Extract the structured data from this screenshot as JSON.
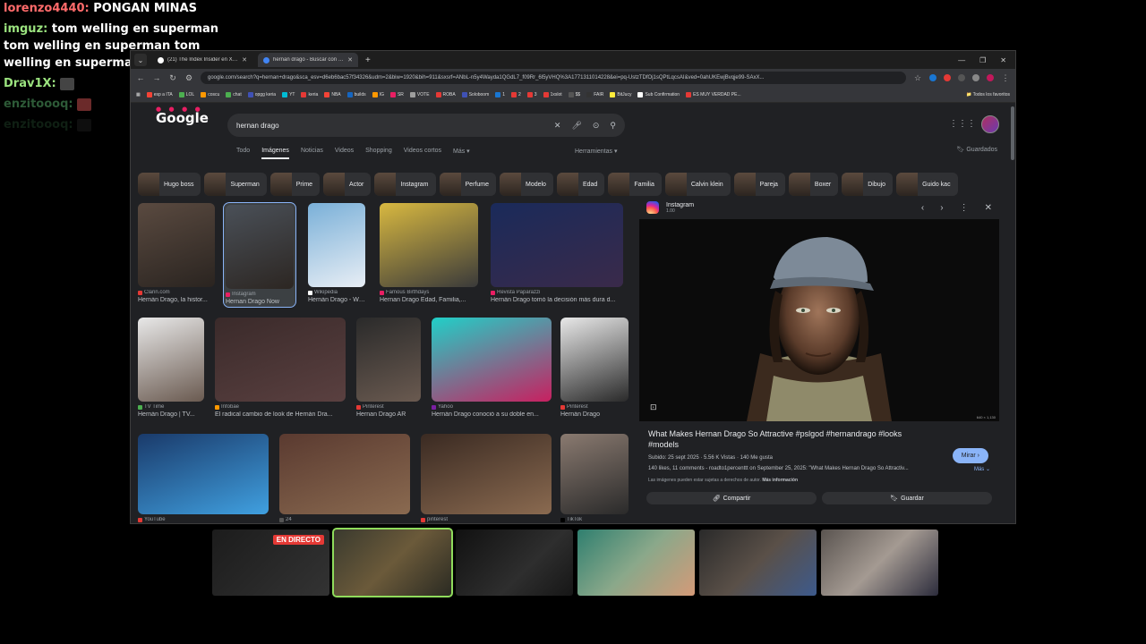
{
  "chat": [
    {
      "user": "lorenzo4440:",
      "msg": "PONGAN MINAS",
      "color": "red"
    },
    {
      "user": "imguz:",
      "msg": "tom welling en superman tom welling en superman tom welling en superman",
      "color": "green"
    },
    {
      "user": "Drav1X:",
      "msg": "",
      "color": "green",
      "emote": true
    },
    {
      "user": "enzitoooq:",
      "msg": "",
      "color": "faint",
      "emote": true
    },
    {
      "user": "enzitoooq:",
      "msg": "",
      "color": "faint",
      "emote": true,
      "faded": true
    }
  ],
  "browser": {
    "tabs": [
      {
        "title": "(21) The Index Insider en X: \"In...",
        "active": false
      },
      {
        "title": "hernan drago - Buscar con Goo...",
        "active": true
      }
    ],
    "url": "google.com/search?q=hernan+drago&sca_esv=d6eb6bac57f34326&udm=2&biw=1920&bih=911&sxsrf=ANbL-n5y4Wayda1QGdL7_f09Rr_6l5yVHQ%3A1771311014228&ei=pq-UstzTDfOj1sQPtLqcsAI&ved=0ahUKEwjBvqje99-SAxX...",
    "bookmarks": [
      "esp a ITA",
      "LOL",
      "coscu",
      "chat",
      "opgg keria",
      "YT",
      "keria",
      "NBA",
      "builds",
      "IG",
      "SR",
      "VOTE",
      "ROBA",
      "Soloboom",
      "1",
      "2",
      "3",
      "1xslot",
      "$$",
      "FAIR",
      "BitJucy",
      "Sub Confirmation",
      "ES MUY VERDAD PE..."
    ],
    "bookmarks_right": "Todos los favoritos"
  },
  "google": {
    "logo": "Google",
    "query": "hernan drago",
    "tabs": [
      "Todo",
      "Imágenes",
      "Noticias",
      "Videos",
      "Shopping",
      "Videos cortos",
      "Más ▾"
    ],
    "selected_tab": "Imágenes",
    "tools": "Herramientas ▾",
    "saved": "Guardados",
    "chips": [
      "Hugo boss",
      "Superman",
      "Prime",
      "Actor",
      "Instagram",
      "Perfume",
      "Modelo",
      "Edad",
      "Familia",
      "Calvin klein",
      "Pareja",
      "Boxer",
      "Dibujo",
      "Guido kac"
    ],
    "results": [
      {
        "source": "Clarin.com",
        "title": "Hernán Drago, la histor..."
      },
      {
        "source": "Instagram",
        "title": "Hernan Drago Now"
      },
      {
        "source": "Wikipedia",
        "title": "Hernán Drago - Wi..."
      },
      {
        "source": "Famous Birthdays",
        "title": "Hernan Drago Edad, Familia,..."
      },
      {
        "source": "Revista Paparazzi",
        "title": "Hernán Drago tomó la decisión más dura d..."
      },
      {
        "source": "TV Time",
        "title": "Hernán Drago | TV..."
      },
      {
        "source": "Infobae",
        "title": "El radical cambio de look de Hernán Dra..."
      },
      {
        "source": "Pinterest",
        "title": "Hernan Drago AR"
      },
      {
        "source": "Yahoo",
        "title": "Hernán Drago conoció a su doble en..."
      },
      {
        "source": "Pinterest",
        "title": "Hernán Drago"
      },
      {
        "source": "YouTube",
        "title": ""
      },
      {
        "source": "24",
        "title": ""
      },
      {
        "source": "pinterest",
        "title": ""
      },
      {
        "source": "TikTok",
        "title": ""
      }
    ],
    "preview": {
      "source": "Instagram",
      "sub": "1.00",
      "dims": "640 × 1,130",
      "title": "What Makes Hernan Drago So Attractive #pslgod #hernandrago #looks #models",
      "button": "Mirar ›",
      "stats": "Subido: 25 sept 2025 · 5.56 K Vistas · 140 Me gusta",
      "desc": "140 likes, 11 comments - roadto1percenttt on September 25, 2025: \"What Makes Hernan Drago So Attractiv...",
      "more": "Más ⌄",
      "rights": "Las imágenes pueden estar sujetas a derechos de autor.",
      "rights_link": "Más información",
      "share": "Compartir",
      "save": "Guardar"
    }
  },
  "stream": {
    "live_label": "EN DIRECTO"
  }
}
